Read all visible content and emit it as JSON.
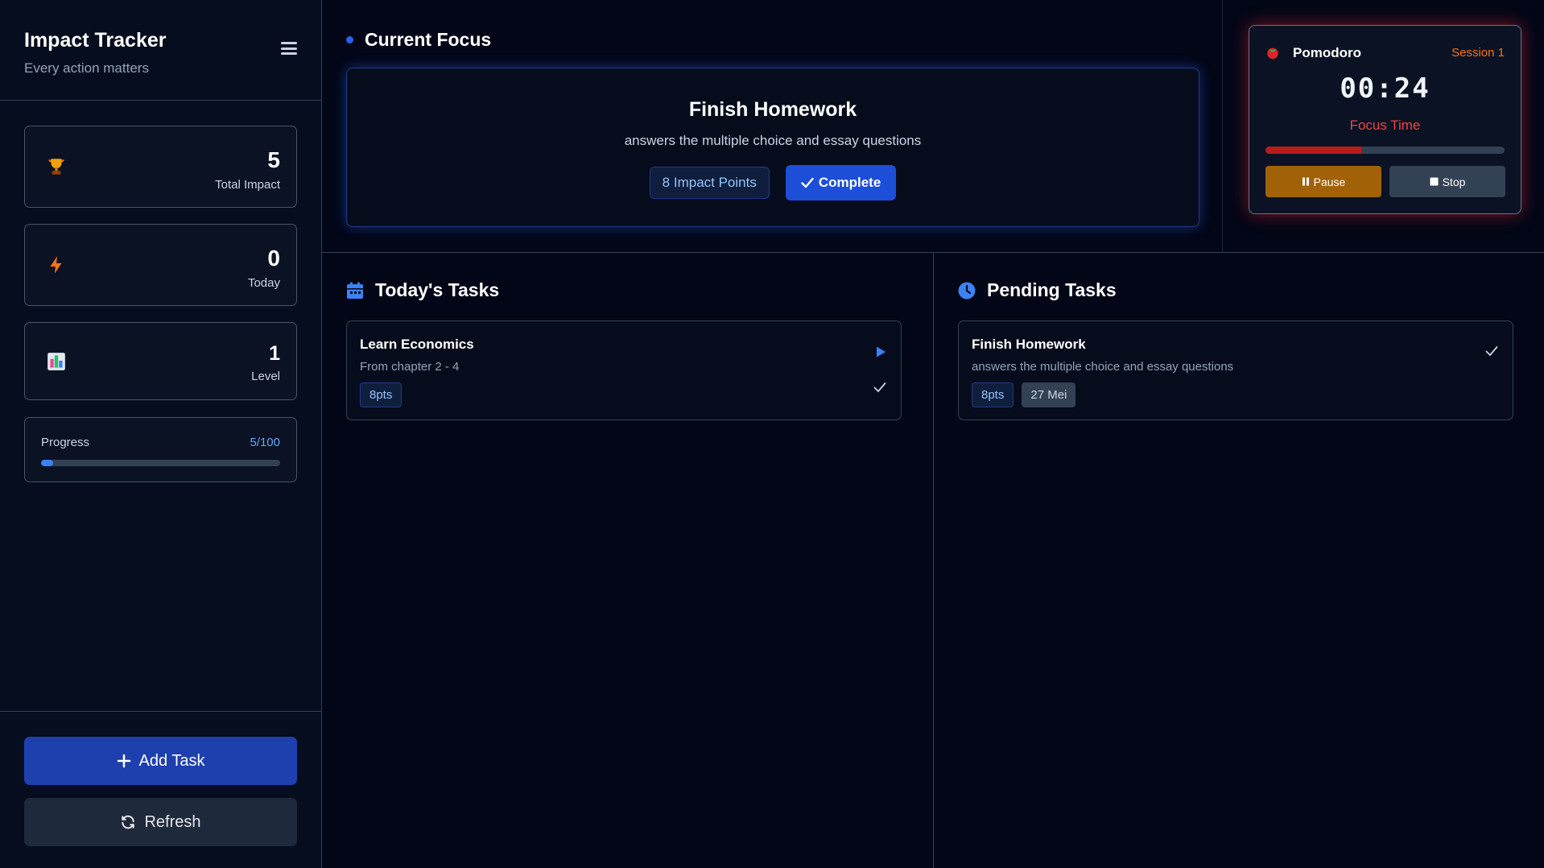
{
  "app": {
    "title": "Impact Tracker",
    "subtitle": "Every action matters"
  },
  "stats": {
    "total_impact": {
      "value": "5",
      "label": "Total Impact",
      "icon": "trophy-icon"
    },
    "today": {
      "value": "0",
      "label": "Today",
      "icon": "lightning-icon"
    },
    "level": {
      "value": "1",
      "label": "Level",
      "icon": "bar-chart-icon"
    }
  },
  "progress": {
    "label": "Progress",
    "value_text": "5/100",
    "fraction": 0.05
  },
  "sidebar_actions": {
    "add_task": "Add Task",
    "refresh": "Refresh"
  },
  "current_focus": {
    "heading": "Current Focus",
    "task_title": "Finish Homework",
    "task_desc": "answers the multiple choice and essay questions",
    "points": "8 Impact Points",
    "complete_label": "Complete"
  },
  "pomodoro": {
    "title": "Pomodoro",
    "session": "Session 1",
    "time": "00:24",
    "mode": "Focus Time",
    "progress_fraction": 0.4,
    "pause_label": "Pause",
    "stop_label": "Stop"
  },
  "todays_tasks": {
    "heading": "Today's Tasks",
    "items": [
      {
        "title": "Learn Economics",
        "desc": "From chapter 2 - 4",
        "points": "8pts"
      }
    ]
  },
  "pending_tasks": {
    "heading": "Pending Tasks",
    "items": [
      {
        "title": "Finish Homework",
        "desc": "answers the multiple choice and essay questions",
        "points": "8pts",
        "date": "27 Mei"
      }
    ]
  },
  "colors": {
    "background": "#020617",
    "accent_blue": "#1d4ed8",
    "pomodoro_red": "#b91c1c",
    "pause_amber": "#a16207",
    "session_orange": "#f97316"
  }
}
